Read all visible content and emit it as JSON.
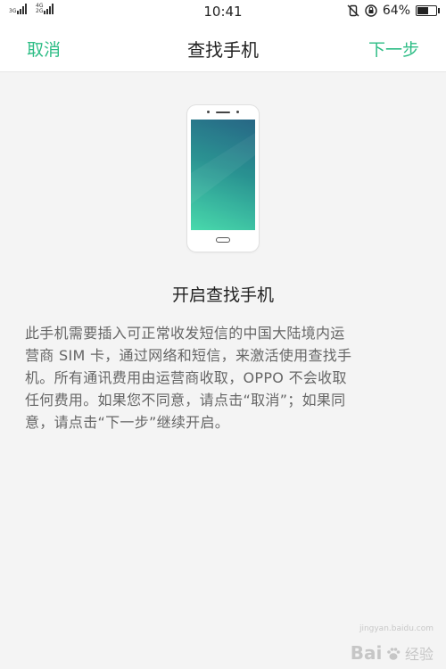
{
  "status_bar": {
    "sim1_tag": "3G",
    "sim2_tag_top": "4G",
    "sim2_tag_bottom": "2G",
    "time": "10:41",
    "battery_percent_text": "64%",
    "battery_level": 0.64,
    "icons": [
      "signal-icon",
      "signal-icon",
      "vibrate-icon",
      "rotation-lock-icon",
      "battery-icon"
    ]
  },
  "nav": {
    "cancel_label": "取消",
    "title": "查找手机",
    "next_label": "下一步",
    "accent_color": "#2ebd86"
  },
  "content": {
    "heading": "开启查找手机",
    "description_lines": [
      "此手机需要插入可正常收发短信的中国大陆境内运",
      "营商 SIM 卡，通过网络和短信，来激活使用查找手",
      "机。所有通讯费用由运营商收取，OPPO 不会收取",
      "任何费用。如果您不同意，请点击“取消”；如果同",
      "意，请点击“下一步”继续开启。"
    ]
  },
  "watermark": {
    "logo_text": "Bai",
    "logo_suffix": "经验",
    "url": "jingyan.baidu.com"
  }
}
